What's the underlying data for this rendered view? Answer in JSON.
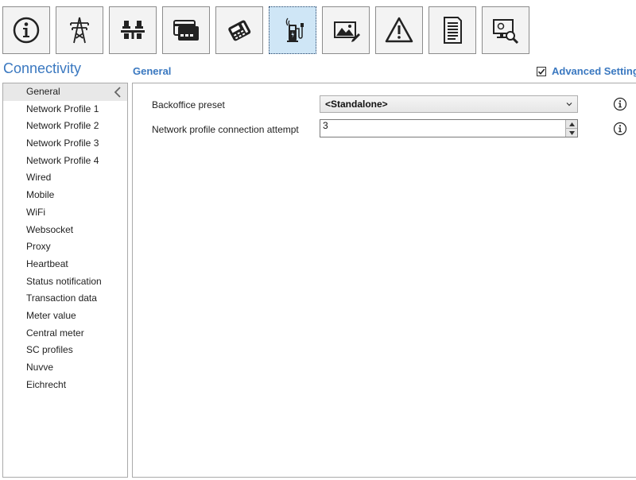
{
  "toolbar": {
    "buttons": [
      {
        "name": "info",
        "icon": "info-icon",
        "active": false
      },
      {
        "name": "power-grid",
        "icon": "power-tower-icon",
        "active": false
      },
      {
        "name": "load-balance",
        "icon": "balance-scale-icon",
        "active": false
      },
      {
        "name": "payment-card",
        "icon": "credit-card-icon",
        "active": false
      },
      {
        "name": "payment-terminal",
        "icon": "card-terminal-icon",
        "active": false
      },
      {
        "name": "connectivity",
        "icon": "charging-station-wireless-icon",
        "active": true
      },
      {
        "name": "display",
        "icon": "image-edit-icon",
        "active": false
      },
      {
        "name": "warnings",
        "icon": "warning-triangle-icon",
        "active": false
      },
      {
        "name": "documents",
        "icon": "document-icon",
        "active": false
      },
      {
        "name": "diagnostics",
        "icon": "monitor-search-icon",
        "active": false
      }
    ]
  },
  "section_title": "Connectivity",
  "page_heading": "General",
  "advanced_settings": {
    "label": "Advanced Settings",
    "checked": true
  },
  "sidebar": {
    "items": [
      {
        "label": "General",
        "active": true
      },
      {
        "label": "Network Profile 1"
      },
      {
        "label": "Network Profile 2"
      },
      {
        "label": "Network Profile 3"
      },
      {
        "label": "Network Profile 4"
      },
      {
        "label": "Wired"
      },
      {
        "label": "Mobile"
      },
      {
        "label": "WiFi"
      },
      {
        "label": "Websocket"
      },
      {
        "label": "Proxy"
      },
      {
        "label": "Heartbeat"
      },
      {
        "label": "Status notification"
      },
      {
        "label": "Transaction data"
      },
      {
        "label": "Meter value"
      },
      {
        "label": "Central meter"
      },
      {
        "label": "SC profiles"
      },
      {
        "label": "Nuvve"
      },
      {
        "label": "Eichrecht"
      }
    ]
  },
  "settings": {
    "backoffice_preset": {
      "label": "Backoffice preset",
      "value": "<Standalone>"
    },
    "connection_attempt": {
      "label": "Network profile connection attempt",
      "value": "3"
    }
  },
  "colors": {
    "accent": "#3a78c0",
    "active_button": "#cfe6f6",
    "border": "#aaaaaa"
  }
}
